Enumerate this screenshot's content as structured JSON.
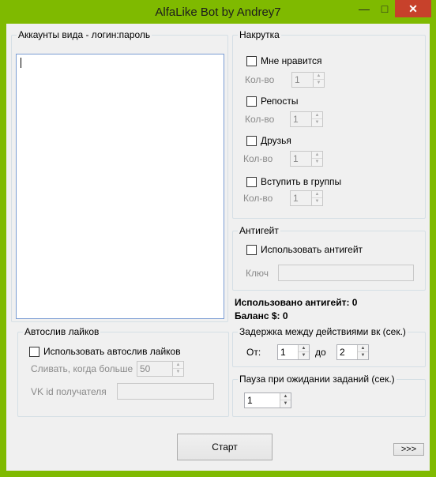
{
  "window": {
    "title": "AlfaLike Bot  by Andrey7",
    "minimize_glyph": "—",
    "maximize_glyph": "□",
    "close_glyph": "✕"
  },
  "accounts": {
    "title": "Аккаунты вида - логин:пароль",
    "value": ""
  },
  "nakrutka": {
    "title": "Накрутка",
    "items": [
      {
        "label": "Мне нравится",
        "checked": false,
        "count_label": "Кол-во",
        "count": "1"
      },
      {
        "label": "Репосты",
        "checked": false,
        "count_label": "Кол-во",
        "count": "1"
      },
      {
        "label": "Друзья",
        "checked": false,
        "count_label": "Кол-во",
        "count": "1"
      },
      {
        "label": "Вступить в группы",
        "checked": false,
        "count_label": "Кол-во",
        "count": "1"
      }
    ]
  },
  "antigate": {
    "title": "Антигейт",
    "use_label": "Использовать антигейт",
    "use_checked": false,
    "key_label": "Ключ",
    "key_value": ""
  },
  "stats": {
    "antigate_used": "Использовано антигейт: 0",
    "balance": "Баланс $: 0"
  },
  "autosliv": {
    "title": "Автослив лайков",
    "use_label": "Использовать автослив лайков",
    "use_checked": false,
    "threshold_label": "Сливать, когда больше",
    "threshold_value": "50",
    "recipient_label": "VK id получателя",
    "recipient_value": ""
  },
  "delay": {
    "title": "Задержка между действиями вк (сек.)",
    "from_label": "От:",
    "from_value": "1",
    "to_label": "до",
    "to_value": "2"
  },
  "pause": {
    "title": "Пауза при ожидании заданий (сек.)",
    "value": "1"
  },
  "buttons": {
    "start": "Старт",
    "more": ">>>"
  },
  "glyphs": {
    "up": "▲",
    "down": "▼"
  }
}
